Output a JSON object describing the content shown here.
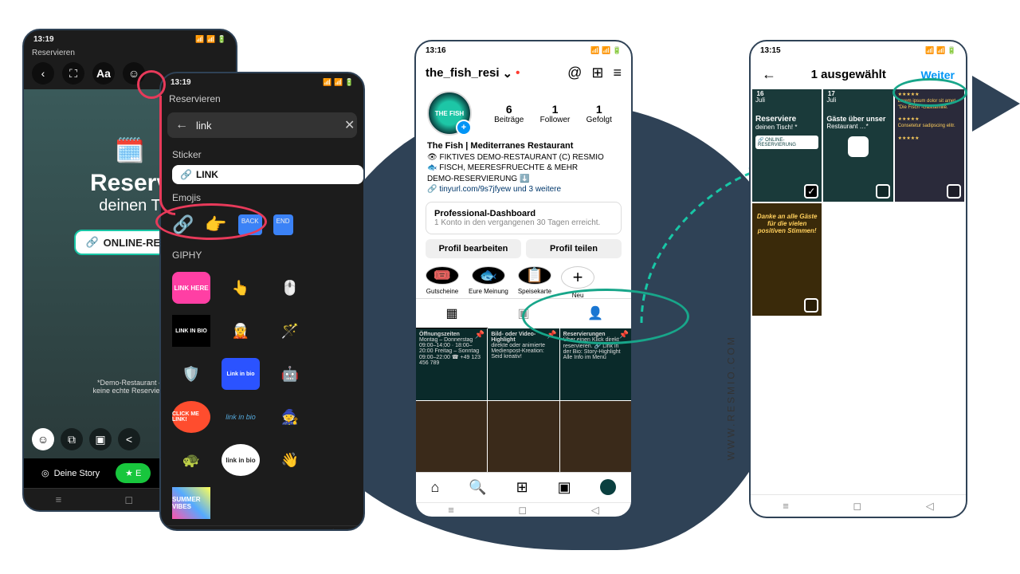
{
  "brand_url": "WWW.RESMIO.COM",
  "phone1": {
    "time": "13:19",
    "toolbar_back": "‹",
    "story_label": "Reservieren",
    "title": "Reserv",
    "subtitle": "deinen T",
    "pill": "ONLINE-RESE",
    "note1": "*Demo-Restaurant –",
    "note2": "keine echte Reservie…",
    "deine_story": "Deine Story"
  },
  "phone2": {
    "time": "13:19",
    "app_label": "Reservieren",
    "search_value": "link",
    "sec_sticker": "Sticker",
    "link_sticker": "LINK",
    "sec_emojis": "Emojis",
    "emoji_back": "BACK",
    "emoji_end": "END",
    "sec_giphy": "GIPHY",
    "gif_linkhere": "LINK HERE",
    "gif_linkinbio": "LINK IN BIO",
    "gif_linkinbio2": "Link in bio",
    "gif_clickme": "CLICK ME LINK!",
    "gif_bubble": "link in bio",
    "gif_summer": "SUMMER VIBES"
  },
  "phone3": {
    "time": "13:16",
    "username": "the_fish_resi",
    "stats": [
      {
        "n": "6",
        "l": "Beiträge"
      },
      {
        "n": "1",
        "l": "Follower"
      },
      {
        "n": "1",
        "l": "Gefolgt"
      }
    ],
    "bio_name": "The Fish | Mediterranes Restaurant",
    "bio_l1": "👁 FIKTIVES DEMO-RESTAURANT (C) RESMIO",
    "bio_l2": "🐟 FISCH, MEERESFRUECHTE & MEHR",
    "bio_l3": "DEMO-RESERVIERUNG ⬇️",
    "bio_link": "🔗 tinyurl.com/9s7jfyew und 3 weitere",
    "dash_t": "Professional-Dashboard",
    "dash_s": "1 Konto in den vergangenen 30 Tagen erreicht.",
    "btn_edit": "Profil bearbeiten",
    "btn_share": "Profil teilen",
    "highlights": [
      {
        "label": "Gutscheine"
      },
      {
        "label": "Eure Meinung"
      },
      {
        "label": "Speisekarte"
      },
      {
        "label": "Neu"
      }
    ],
    "posts": [
      {
        "t": "Öffnungszeiten",
        "s": "Montag – Donnerstag\n09:00–14:00 · 18:00–20:00\nFreitag – Sonntag\n09:00–22:00\n☎ +49 123 456 789"
      },
      {
        "t": "Bild- oder Video-Highlight",
        "s": "direkte oder animierte Medienpost-Kreation: Seid kreativ!"
      },
      {
        "t": "Reservierungen",
        "s": "Über einen Klick direkt reservieren.\n🔗 Link in der Bio: Story-Highlight\nAlle Info im Menü"
      }
    ]
  },
  "phone4": {
    "time": "13:15",
    "title": "1 ausgewählt",
    "next": "Weiter",
    "cells": [
      {
        "d": "16",
        "m": "Juli",
        "t": "Reserviere",
        "s": "deinen Tisch! *",
        "pill": "🔗 ONLINE-RESERVIERUNG",
        "checked": true
      },
      {
        "d": "17",
        "m": "Juli",
        "t": "Gäste über unser",
        "s": "Restaurant …*",
        "checked": false
      },
      {
        "d": "",
        "m": "",
        "t": "",
        "s": "",
        "checked": false
      }
    ],
    "thanks": "Danke an alle Gäste für die vielen positiven Stimmen!"
  }
}
